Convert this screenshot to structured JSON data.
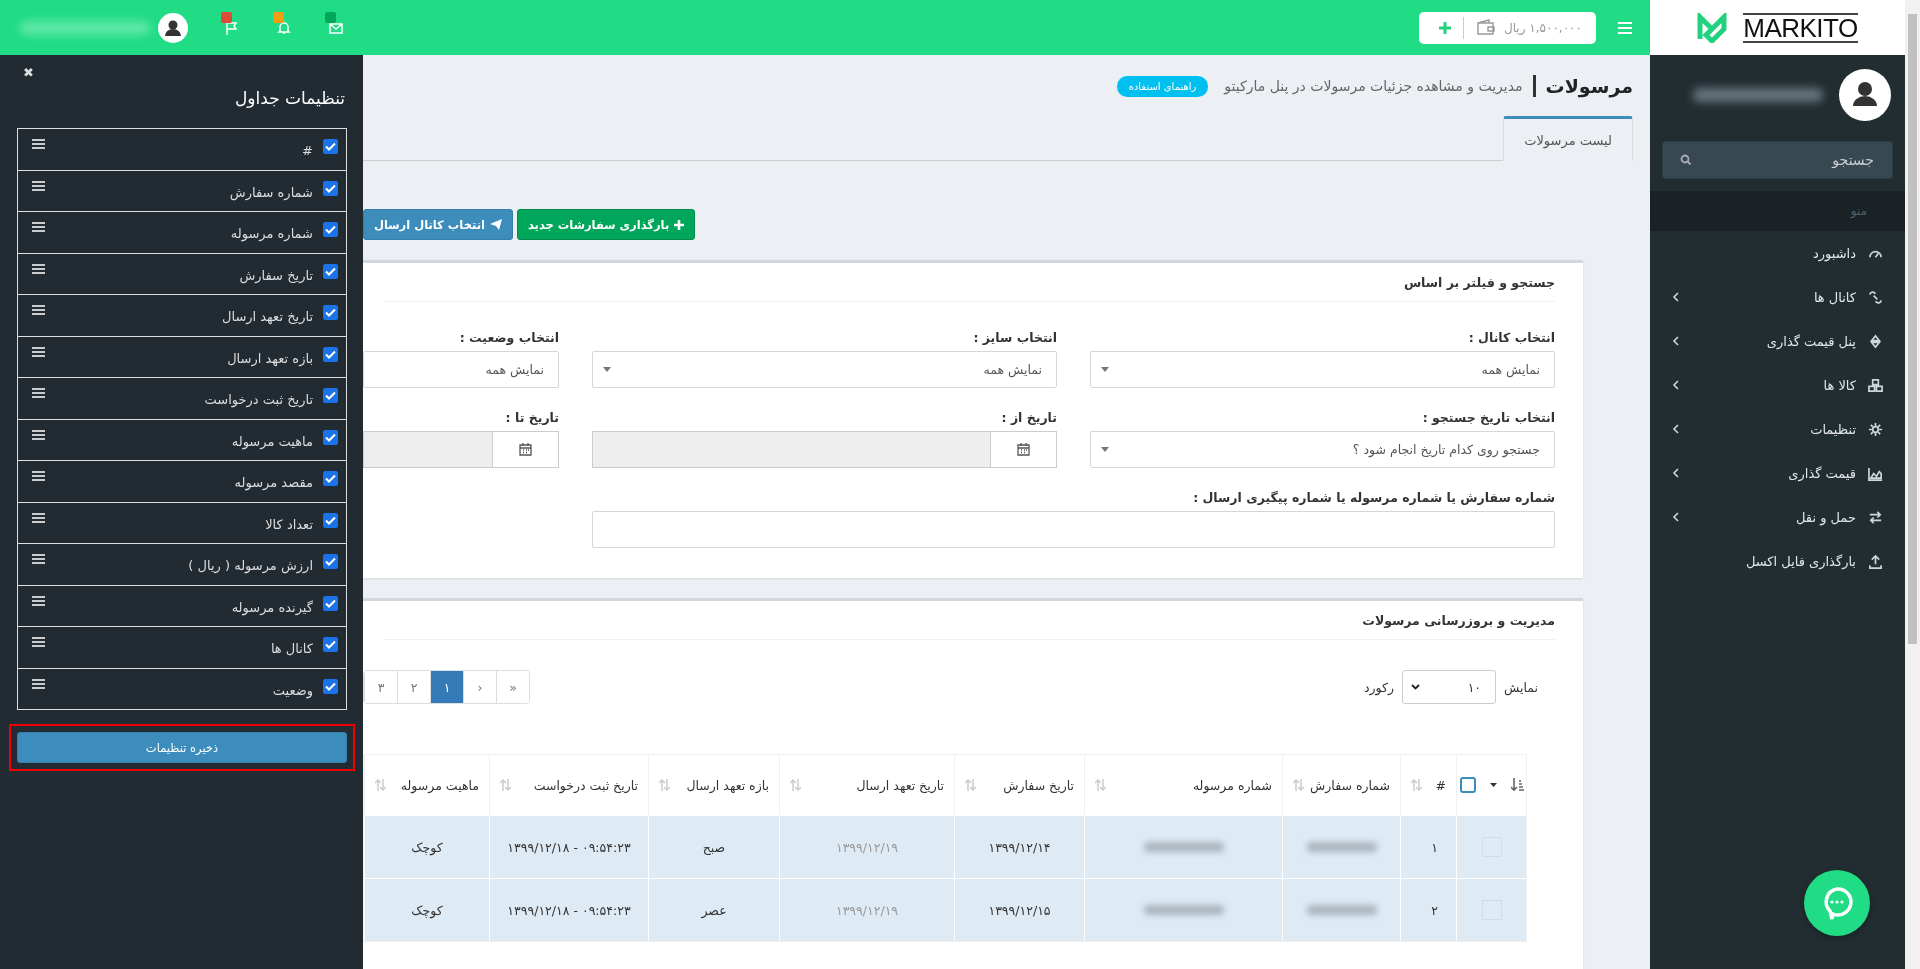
{
  "top_bar": {
    "balance": "۱,۵۰۰,۰۰۰ ریال",
    "alerts": [
      {
        "kind": "mail",
        "color": "#00a65a"
      },
      {
        "kind": "bell",
        "color": "#f39c12"
      },
      {
        "kind": "flag",
        "color": "#dd4b39"
      }
    ]
  },
  "sidebar": {
    "logo": "MARKITO",
    "search": {
      "placeholder": "جستجو"
    },
    "menu_header": "منو",
    "items": [
      {
        "label": "داشبورد",
        "has_submenu": false
      },
      {
        "label": "کانال ها",
        "has_submenu": true
      },
      {
        "label": "پنل قیمت گذاری",
        "has_submenu": true
      },
      {
        "label": "کالا ها",
        "has_submenu": true
      },
      {
        "label": "تنظیمات",
        "has_submenu": true
      },
      {
        "label": "قیمت گذاری",
        "has_submenu": true
      },
      {
        "label": "حمل و نقل",
        "has_submenu": true
      },
      {
        "label": "بارگذاری فایل اکسل",
        "has_submenu": false
      }
    ]
  },
  "page": {
    "title": "مرسولات",
    "subtitle": "مدیریت و مشاهده جزئیات مرسولات در پنل مارکیتو",
    "help": "راهنمای استفاده",
    "tabs": [
      {
        "label": "لیست مرسولات",
        "selected": true
      }
    ],
    "actions": [
      {
        "label": "بارگذاری سفارشات جدید",
        "kind": "success"
      },
      {
        "label": "انتخاب کانال ارسال",
        "kind": "primary"
      }
    ]
  },
  "filter": {
    "title": "جستجو و فیلتر بر اساس",
    "fields": [
      {
        "label": "انتخاب کانال :",
        "kind": "select",
        "value": "نمایش همه"
      },
      {
        "label": "انتخاب سایز :",
        "kind": "select",
        "value": "نمایش همه"
      },
      {
        "label": "انتخاب وضعیت :",
        "kind": "plain",
        "value": "نمایش همه"
      },
      {
        "label": "انتخاب تاریخ جستجو :",
        "kind": "select",
        "value": "جستجو روی کدام تاریخ انجام شود ؟"
      },
      {
        "label": "تاریخ از :",
        "kind": "date"
      },
      {
        "label": "تاریخ تا :",
        "kind": "date"
      },
      {
        "label": "شماره سفارش یا شماره مرسوله یا شماره پیگیری ارسال :",
        "kind": "wide"
      }
    ]
  },
  "shipments": {
    "title": "مدیریت و بروزرسانی مرسولات",
    "select_all": {
      "checked": false
    },
    "show_label": "نمایش",
    "page_size": "۱۰",
    "records_label": "رکورد",
    "pagination": [
      {
        "label": "«",
        "selected": false
      },
      {
        "label": "‹",
        "selected": false
      },
      {
        "label": "۱",
        "selected": true
      },
      {
        "label": "۲",
        "selected": false
      },
      {
        "label": "۳",
        "selected": false
      }
    ],
    "columns": [
      "#",
      "شماره سفارش",
      "شماره مرسوله",
      "تاریخ سفارش",
      "تاریخ تعهد ارسال",
      "بازه تعهد ارسال",
      "تاریخ ثبت درخواست",
      "ماهیت مرسوله"
    ],
    "rows": [
      {
        "checked": false,
        "number": "۱",
        "order_date": "۱۳۹۹/۱۲/۱۴",
        "commit_date": "۱۳۹۹/۱۲/۱۹",
        "commit_range": "صبح",
        "request_date": "۱۳۹۹/۱۲/۱۸ - ۰۹:۵۴:۲۳",
        "nature": "کوچک"
      },
      {
        "checked": false,
        "number": "۲",
        "order_date": "۱۳۹۹/۱۲/۱۵",
        "commit_date": "۱۳۹۹/۱۲/۱۹",
        "commit_range": "عصر",
        "request_date": "۱۳۹۹/۱۲/۱۸ - ۰۹:۵۴:۲۳",
        "nature": "کوچک"
      }
    ]
  },
  "column_settings": {
    "title": "تنظیمات جداول",
    "close": "✖",
    "save": "ذخیره تنظیمات",
    "columns": [
      {
        "label": "#",
        "checked": true
      },
      {
        "label": "شماره سفارش",
        "checked": true
      },
      {
        "label": "شماره مرسوله",
        "checked": true
      },
      {
        "label": "تاریخ سفارش",
        "checked": true
      },
      {
        "label": "تاریخ تعهد ارسال",
        "checked": true
      },
      {
        "label": "بازه تعهد ارسال",
        "checked": true
      },
      {
        "label": "تاریخ ثبت درخواست",
        "checked": true
      },
      {
        "label": "ماهیت مرسوله",
        "checked": true
      },
      {
        "label": "مقصد مرسوله",
        "checked": true
      },
      {
        "label": "تعداد کالا",
        "checked": true
      },
      {
        "label": "ارزش مرسوله ( ریال )",
        "checked": true
      },
      {
        "label": "گیرنده مرسوله",
        "checked": true
      },
      {
        "label": "کانال ها",
        "checked": true
      },
      {
        "label": "وضعیت",
        "checked": true
      }
    ]
  }
}
